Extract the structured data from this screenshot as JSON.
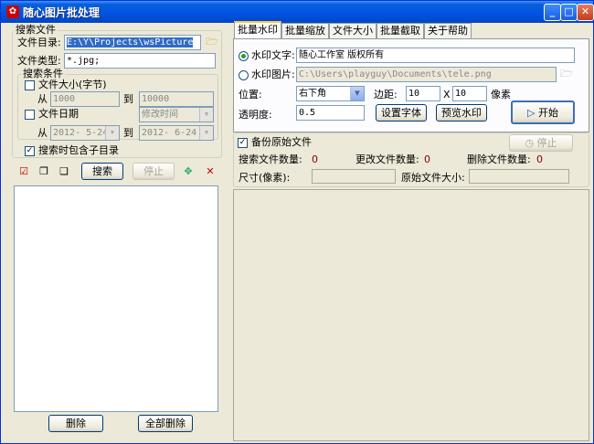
{
  "window": {
    "title": "随心图片批处理"
  },
  "left": {
    "search_group": "搜索文件",
    "dir_label": "文件目录:",
    "dir_value": "E:\\Y\\Projects\\wsPicture",
    "type_label": "文件类型:",
    "type_value": "*.jpg;",
    "cond_group": "搜索条件",
    "size_check": "文件大小(字节)",
    "size_from_label": "从",
    "size_from": "1000",
    "size_to_label": "到",
    "size_to": "10000",
    "date_check": "文件日期",
    "date_type": "修改时间",
    "date_from_label": "从",
    "date_from": "2012- 5-24",
    "date_to_label": "到",
    "date_to": "2012- 6-24",
    "subdir_check": "搜索时包含子目录",
    "subdir_mark": "✓",
    "search_btn": "搜索",
    "stop_btn": "停止",
    "delete_btn": "删除",
    "delete_all_btn": "全部删除"
  },
  "tabs": [
    "批量水印",
    "批量缩放",
    "文件大小",
    "批量截取",
    "关于帮助"
  ],
  "watermark": {
    "text_radio": "水印文字:",
    "text_value": "随心工作室  版权所有",
    "image_radio": "水印图片:",
    "image_value": "C:\\Users\\playguy\\Documents\\tele.png",
    "position_label": "位置:",
    "position_value": "右下角",
    "margin_label": "边距:",
    "margin_x": "10",
    "margin_sep": "X",
    "margin_y": "10",
    "margin_unit": "像素",
    "opacity_label": "透明度:",
    "opacity_value": "0.5",
    "font_btn": "设置字体",
    "preview_btn": "预览水印",
    "start_btn": "开始",
    "backup_check": "备份原始文件",
    "backup_mark": "✓",
    "stop_btn": "停止"
  },
  "stats": {
    "search_count_label": "搜索文件数量:",
    "search_count": "0",
    "changed_count_label": "更改文件数量:",
    "changed_count": "0",
    "deleted_count_label": "删除文件数量:",
    "deleted_count": "0",
    "size_label": "尺寸(像素):",
    "orig_size_label": "原始文件大小:"
  },
  "colors": {
    "title_blue": "#0053e1",
    "selection": "#316ac5",
    "tab_highlight": "#ffc83c"
  }
}
